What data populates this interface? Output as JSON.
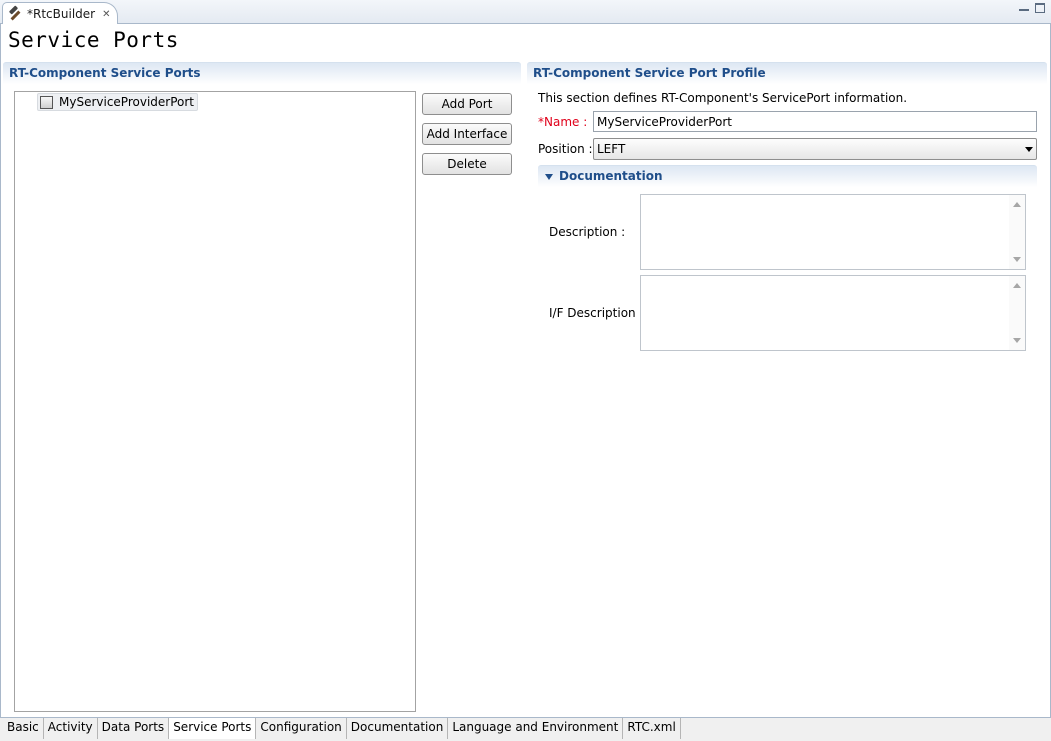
{
  "editor_tab": {
    "title": "*RtcBuilder",
    "icon": "hammer-icon"
  },
  "page": {
    "title": "Service Ports"
  },
  "left_section": {
    "title": "RT-Component Service Ports",
    "tree_items": [
      {
        "label": "MyServiceProviderPort",
        "icon": "service-port-icon"
      }
    ],
    "buttons": {
      "add_port": "Add Port",
      "add_interface": "Add Interface",
      "delete": "Delete"
    }
  },
  "right_section": {
    "title": "RT-Component Service Port Profile",
    "description": "This section defines RT-Component's ServicePort information.",
    "name": {
      "label": "*Name :",
      "value": "MyServiceProviderPort",
      "label_color": "#e0001a"
    },
    "position": {
      "label": "Position :",
      "value": "LEFT"
    },
    "documentation": {
      "title": "Documentation",
      "description_label": "Description :",
      "if_description_label": "I/F Description :"
    }
  },
  "bottom_tabs": [
    {
      "label": "Basic",
      "active": false
    },
    {
      "label": "Activity",
      "active": false
    },
    {
      "label": "Data Ports",
      "active": false
    },
    {
      "label": "Service Ports",
      "active": true
    },
    {
      "label": "Configuration",
      "active": false
    },
    {
      "label": "Documentation",
      "active": false
    },
    {
      "label": "Language and Environment",
      "active": false
    },
    {
      "label": "RTC.xml",
      "active": false
    }
  ],
  "colors": {
    "section_header_text": "#1f4e8a",
    "frame_border": "#a9b8ca"
  }
}
